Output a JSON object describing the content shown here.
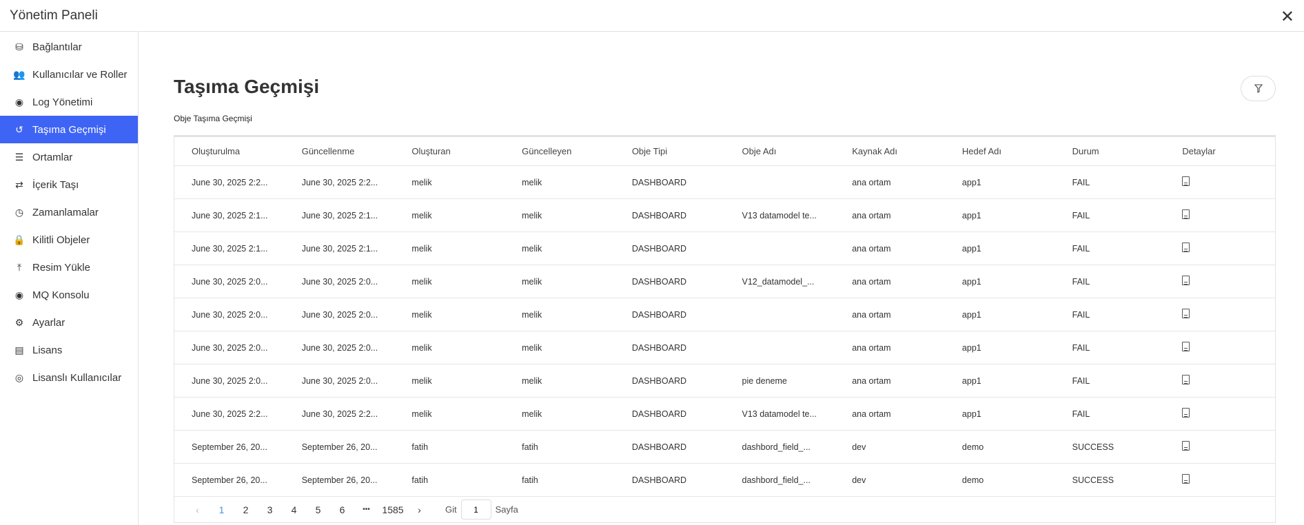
{
  "window": {
    "title": "Yönetim Paneli"
  },
  "sidebar": {
    "items": [
      {
        "label": "Bağlantılar",
        "icon": "database-icon",
        "glyph": "⛁"
      },
      {
        "label": "Kullanıcılar ve Roller",
        "icon": "users-icon",
        "glyph": "👥"
      },
      {
        "label": "Log Yönetimi",
        "icon": "log-eye-icon",
        "glyph": "◉"
      },
      {
        "label": "Taşıma Geçmişi",
        "icon": "history-icon",
        "glyph": "↺",
        "active": true
      },
      {
        "label": "Ortamlar",
        "icon": "list-icon",
        "glyph": "☰"
      },
      {
        "label": "İçerik Taşı",
        "icon": "transfer-icon",
        "glyph": "⇄"
      },
      {
        "label": "Zamanlamalar",
        "icon": "clock-icon",
        "glyph": "◷"
      },
      {
        "label": "Kilitli Objeler",
        "icon": "lock-icon",
        "glyph": "🔒"
      },
      {
        "label": "Resim Yükle",
        "icon": "upload-icon",
        "glyph": "⤒"
      },
      {
        "label": "MQ Konsolu",
        "icon": "console-icon",
        "glyph": "◉"
      },
      {
        "label": "Ayarlar",
        "icon": "gear-icon",
        "glyph": "⚙"
      },
      {
        "label": "Lisans",
        "icon": "license-file-icon",
        "glyph": "▤"
      },
      {
        "label": "Lisanslı Kullanıcılar",
        "icon": "licensed-user-icon",
        "glyph": "◎"
      }
    ]
  },
  "main": {
    "title": "Taşıma Geçmişi",
    "subtitle": "Obje Taşıma Geçmişi",
    "filter_icon": "filter-icon"
  },
  "table": {
    "columns": [
      "Oluşturulma",
      "Güncellenme",
      "Oluşturan",
      "Güncelleyen",
      "Obje Tipi",
      "Obje Adı",
      "Kaynak Adı",
      "Hedef Adı",
      "Durum",
      "Detaylar"
    ],
    "rows": [
      [
        "June 30, 2025 2:2...",
        "June 30, 2025 2:2...",
        "melik",
        "melik",
        "DASHBOARD",
        "",
        "ana ortam",
        "app1",
        "FAIL"
      ],
      [
        "June 30, 2025 2:1...",
        "June 30, 2025 2:1...",
        "melik",
        "melik",
        "DASHBOARD",
        "V13 datamodel te...",
        "ana ortam",
        "app1",
        "FAIL"
      ],
      [
        "June 30, 2025 2:1...",
        "June 30, 2025 2:1...",
        "melik",
        "melik",
        "DASHBOARD",
        "",
        "ana ortam",
        "app1",
        "FAIL"
      ],
      [
        "June 30, 2025 2:0...",
        "June 30, 2025 2:0...",
        "melik",
        "melik",
        "DASHBOARD",
        "V12_datamodel_...",
        "ana ortam",
        "app1",
        "FAIL"
      ],
      [
        "June 30, 2025 2:0...",
        "June 30, 2025 2:0...",
        "melik",
        "melik",
        "DASHBOARD",
        "",
        "ana ortam",
        "app1",
        "FAIL"
      ],
      [
        "June 30, 2025 2:0...",
        "June 30, 2025 2:0...",
        "melik",
        "melik",
        "DASHBOARD",
        "",
        "ana ortam",
        "app1",
        "FAIL"
      ],
      [
        "June 30, 2025 2:0...",
        "June 30, 2025 2:0...",
        "melik",
        "melik",
        "DASHBOARD",
        "pie deneme",
        "ana ortam",
        "app1",
        "FAIL"
      ],
      [
        "June 30, 2025 2:2...",
        "June 30, 2025 2:2...",
        "melik",
        "melik",
        "DASHBOARD",
        "V13 datamodel te...",
        "ana ortam",
        "app1",
        "FAIL"
      ],
      [
        "September 26, 20...",
        "September 26, 20...",
        "fatih",
        "fatih",
        "DASHBOARD",
        "dashbord_field_...",
        "dev",
        "demo",
        "SUCCESS"
      ],
      [
        "September 26, 20...",
        "September 26, 20...",
        "fatih",
        "fatih",
        "DASHBOARD",
        "dashbord_field_...",
        "dev",
        "demo",
        "SUCCESS"
      ]
    ]
  },
  "pagination": {
    "prev": "‹",
    "pages": [
      "1",
      "2",
      "3",
      "4",
      "5",
      "6"
    ],
    "current": "1",
    "ellipsis": "•••",
    "last": "1585",
    "next": "›",
    "goto_label": "Git",
    "goto_value": "1",
    "page_label": "Sayfa"
  },
  "colors": {
    "accent": "#3e64f6",
    "current_page": "#4a90e2"
  }
}
